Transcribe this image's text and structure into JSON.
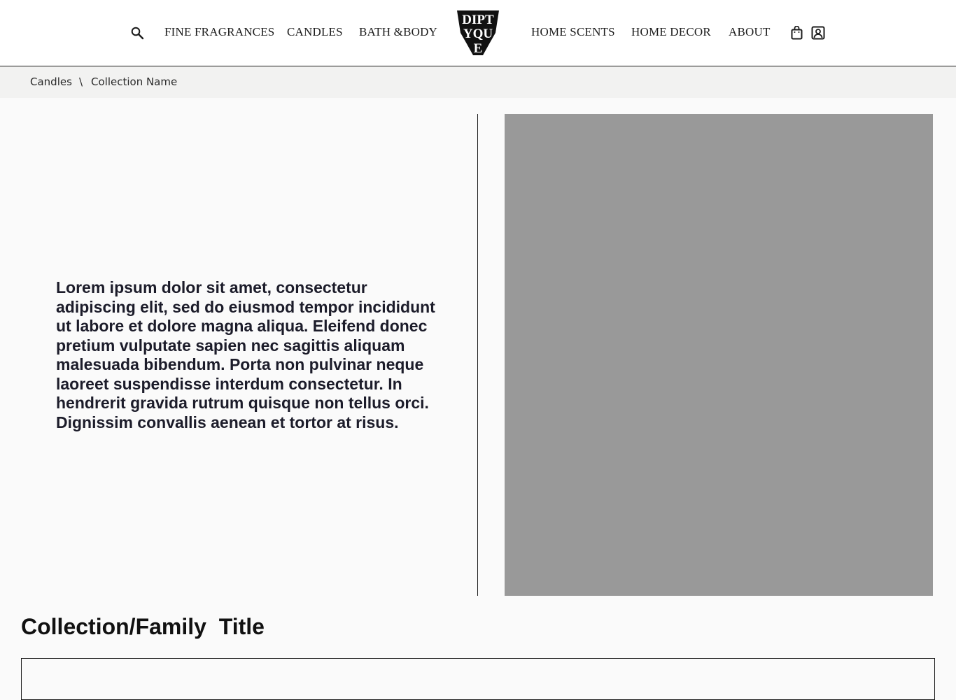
{
  "header": {
    "logo_text": "DIPTYQUE",
    "nav_left": [
      "FINE FRAGRANCES",
      "CANDLES",
      "BATH &BODY"
    ],
    "nav_right": [
      "HOME SCENTS",
      "HOME DECOR",
      "ABOUT"
    ],
    "icons": [
      "search-icon",
      "shopping-bag-icon",
      "account-icon"
    ]
  },
  "breadcrumb": {
    "items": [
      "Candles",
      "Collection Name"
    ],
    "separator": "\\"
  },
  "intro": {
    "text": "Lorem ipsum dolor sit amet, consectetur adipiscing elit, sed do eiusmod tempor incididunt ut labore et dolore magna aliqua. Eleifend donec pretium vulputate sapien nec sagittis aliquam malesuada bibendum. Porta non pulvinar neque laoreet suspendisse interdum consectetur. In hendrerit gravida rutrum quisque non tellus orci. Dignissim convallis aenean et tortor at risus."
  },
  "collection": {
    "title": "Collection/Family  Title"
  },
  "colors": {
    "page_background": "#fafafa",
    "header_background": "#ffffff",
    "breadcrumb_background": "#f2f2f1",
    "image_placeholder": "#999999",
    "text_dark": "#1c1c2a"
  }
}
